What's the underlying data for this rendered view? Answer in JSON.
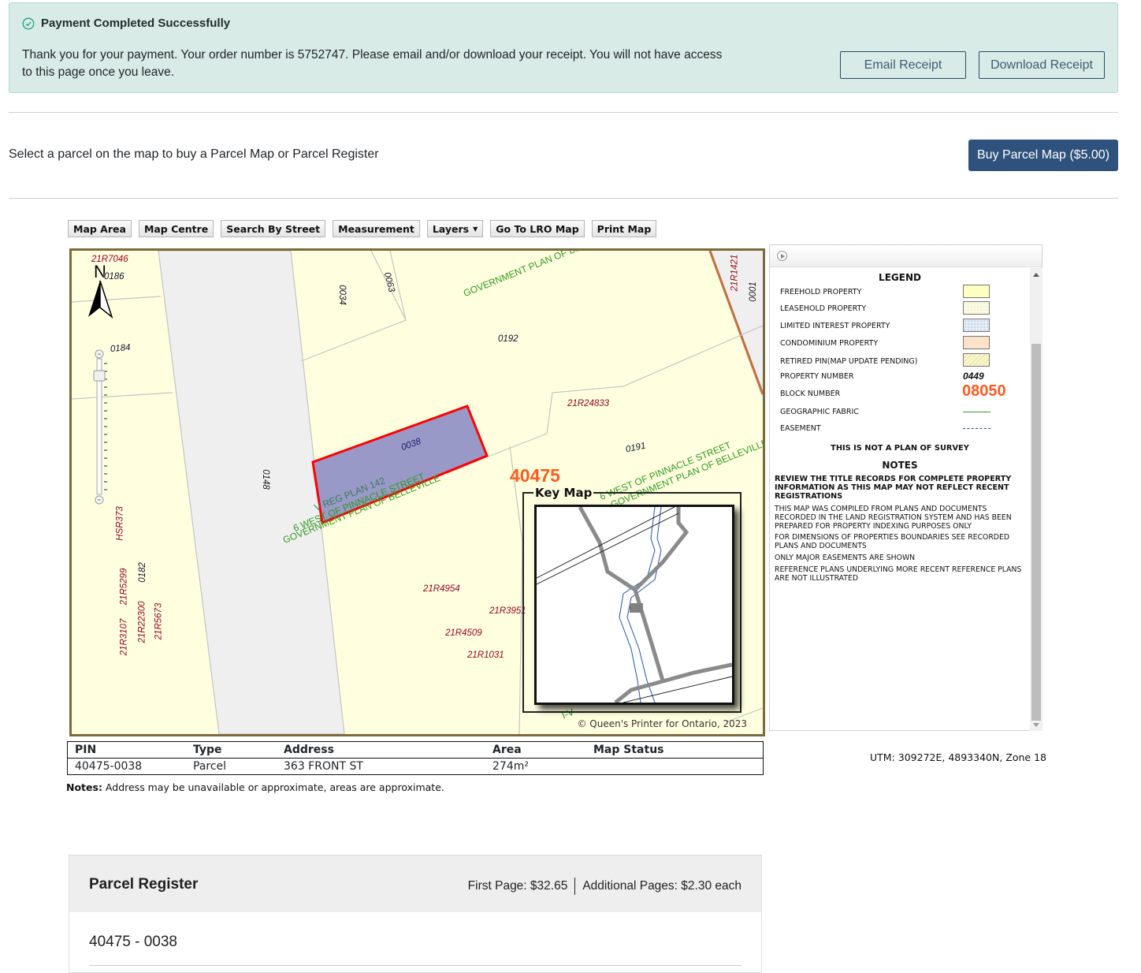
{
  "banner": {
    "title": "Payment Completed Successfully",
    "message": "Thank you for your payment. Your order number is 5752747. Please email and/or download your receipt. You will not have access to this page once you leave.",
    "order_number": "5752747",
    "email_receipt_label": "Email Receipt",
    "download_receipt_label": "Download Receipt",
    "status_icon": "check-circle-icon",
    "accent_color": "#1e9e7c"
  },
  "selection": {
    "instruction": "Select a parcel on the map to buy a Parcel Map or Parcel Register",
    "buy_map_label": "Buy Parcel Map ($5.00)"
  },
  "toolbar": {
    "buttons": [
      "Map Area",
      "Map Centre",
      "Search By Street",
      "Measurement",
      "Layers",
      "Go To LRO Map",
      "Print Map"
    ]
  },
  "map": {
    "north_label": "N",
    "block_number": "40475",
    "selected_parcel_label": "0038",
    "property_numbers": [
      "0186",
      "0184",
      "0034",
      "0063",
      "0192",
      "0001",
      "0191",
      "0148",
      "0182"
    ],
    "plan_labels": [
      "21R7046",
      "21R1421",
      "21R24833",
      "HSR373",
      "21R5299",
      "21R3107",
      "21R22300",
      "21R5673",
      "21R4954",
      "21R3951",
      "21R4509",
      "21R1031"
    ],
    "fabric_labels": [
      "GOVERNMENT PLAN OF BELLEVILLE",
      "6 WEST OF PINNACLE STREET",
      "GOVERNMENT PLAN OF BELLEVILLE",
      "V REG PLAN 142",
      "6 WEST OF PINNACLE STREET",
      "GOVERNMENT PLAN OF BELLEVILLE",
      "I-V"
    ],
    "key_map_title": "Key Map",
    "copyright": "© Queen's Printer for Ontario, 2023"
  },
  "legend": {
    "title": "LEGEND",
    "items": [
      {
        "label": "FREEHOLD PROPERTY",
        "swatch": "#ffffc0"
      },
      {
        "label": "LEASEHOLD PROPERTY",
        "swatch": "#fdfbe4"
      },
      {
        "label": "LIMITED INTEREST PROPERTY",
        "swatch": "#e4ecf6"
      },
      {
        "label": "CONDOMINIUM PROPERTY",
        "swatch": "#fae3c9"
      },
      {
        "label": "RETIRED PIN(MAP UPDATE PENDING)",
        "swatch": "#f8f6cc"
      },
      {
        "label": "PROPERTY NUMBER",
        "sample": "0449"
      },
      {
        "label": "BLOCK NUMBER",
        "sample": "08050"
      },
      {
        "label": "GEOGRAPHIC FABRIC",
        "line_color": "#3a9a2a"
      },
      {
        "label": "EASEMENT",
        "line_color": "#2b4a8a"
      }
    ],
    "disclaimer": "THIS IS NOT A PLAN OF SURVEY",
    "notes_title": "NOTES",
    "notes": [
      "REVIEW THE TITLE RECORDS FOR COMPLETE PROPERTY INFORMATION AS THIS MAP MAY NOT REFLECT RECENT REGISTRATIONS",
      "THIS MAP WAS COMPILED FROM PLANS AND DOCUMENTS RECORDED IN THE LAND REGISTRATION SYSTEM AND HAS BEEN PREPARED FOR PROPERTY INDEXING PURPOSES ONLY",
      "FOR DIMENSIONS OF PROPERTIES BOUNDARIES SEE RECORDED PLANS AND DOCUMENTS",
      "ONLY MAJOR EASEMENTS ARE SHOWN",
      "REFERENCE PLANS UNDERLYING MORE RECENT REFERENCE PLANS ARE NOT ILLUSTRATED"
    ]
  },
  "parcel_table": {
    "columns": [
      "PIN",
      "Type",
      "Address",
      "Area",
      "Map Status"
    ],
    "rows": [
      {
        "pin": "40475-0038",
        "type": "Parcel",
        "address": "363 FRONT ST",
        "area": "274m²",
        "map_status": ""
      }
    ],
    "notes_label": "Notes:",
    "notes_text": " Address may be unavailable or approximate, areas are approximate."
  },
  "utm": "UTM: 309272E, 4893340N, Zone 18",
  "parcel_register": {
    "title": "Parcel Register",
    "first_page": "First Page: $32.65",
    "additional_pages": "Additional Pages: $2.30 each",
    "pin": "40475 - 0038"
  }
}
